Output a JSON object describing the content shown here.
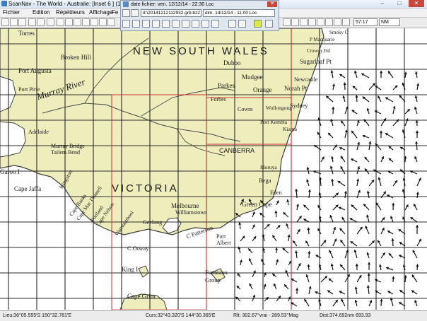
{
  "window": {
    "title": "ScanNav - The World - Australie: [Inset 6 ] (1:122...",
    "controls": {
      "minimize": "–",
      "maximize": "□",
      "close": "✕"
    }
  },
  "menu": {
    "items": [
      "Fichier",
      "Edition",
      "Répétiteurs",
      "Affichage",
      "Fe"
    ]
  },
  "toolbar": {
    "scale_value": "57:17",
    "unit_value": "NM"
  },
  "grib_panel": {
    "title": "date fichier: ven. 12/12/14 - 22:30 Loc",
    "file_path": "d:\\20141212112932.grb.bz2",
    "date_value": "dim. 14/12/14 - 11:00 Loc",
    "close_label": "✕"
  },
  "map": {
    "regions": [
      {
        "id": "nsw",
        "text": "NEW SOUTH WALES"
      },
      {
        "id": "vic",
        "text": "VICTORIA"
      }
    ],
    "places": [
      {
        "id": "torres",
        "text": "Torres"
      },
      {
        "id": "broken-hill",
        "text": "Broken Hill"
      },
      {
        "id": "port-augusta",
        "text": "Port Augusta"
      },
      {
        "id": "port-pirie",
        "text": "Port Pirie"
      },
      {
        "id": "murray-river",
        "text": "Murray River"
      },
      {
        "id": "adelaide",
        "text": "Adelaide"
      },
      {
        "id": "murray-bridge",
        "text": "Murray Bridge"
      },
      {
        "id": "tailem-bend",
        "text": "Tailem Bend"
      },
      {
        "id": "kingston",
        "text": "Kingston"
      },
      {
        "id": "cape-jaffa",
        "text": "Cape Jaffa"
      },
      {
        "id": "cape-banks",
        "text": "Cape Banks"
      },
      {
        "id": "cape-mac-donnell",
        "text": "Cape Mac Donnell"
      },
      {
        "id": "portland",
        "text": "Portland"
      },
      {
        "id": "cape-nelson",
        "text": "Cape Nelson"
      },
      {
        "id": "warrnambool",
        "text": "Warrnambool"
      },
      {
        "id": "dubbo",
        "text": "Dubbo"
      },
      {
        "id": "mudgee",
        "text": "Mudgee"
      },
      {
        "id": "parkes",
        "text": "Parkes"
      },
      {
        "id": "orange",
        "text": "Orange"
      },
      {
        "id": "forbes",
        "text": "Forbes"
      },
      {
        "id": "cowra",
        "text": "Cowra"
      },
      {
        "id": "canberra",
        "text": "CANBERRA"
      },
      {
        "id": "wollongong",
        "text": "Wollongong"
      },
      {
        "id": "port-kembla",
        "text": "Port Kembla"
      },
      {
        "id": "kiama",
        "text": "Kiama"
      },
      {
        "id": "sydney",
        "text": "Sydney"
      },
      {
        "id": "newcastle",
        "text": "Newcastle"
      },
      {
        "id": "norah-pt",
        "text": "Norah Pt"
      },
      {
        "id": "sugarloaf-pt",
        "text": "Sugarloaf Pt"
      },
      {
        "id": "crowdy-hd",
        "text": "Crowdy Hd"
      },
      {
        "id": "p-macquarie",
        "text": "P Macquarie"
      },
      {
        "id": "smoky-c",
        "text": "Smoky C"
      },
      {
        "id": "moruya",
        "text": "Moruya"
      },
      {
        "id": "bega",
        "text": "Bega"
      },
      {
        "id": "eden",
        "text": "Eden"
      },
      {
        "id": "green-cape",
        "text": "Green Cape"
      },
      {
        "id": "melbourne",
        "text": "Melbourne"
      },
      {
        "id": "williamstown",
        "text": "Williamstown"
      },
      {
        "id": "geelong",
        "text": "Geelong"
      },
      {
        "id": "c-patterson",
        "text": "C Patterson"
      },
      {
        "id": "c-otway",
        "text": "C Otway"
      },
      {
        "id": "port-albert",
        "text": "Port Albert"
      },
      {
        "id": "king-i",
        "text": "King I"
      },
      {
        "id": "furneaux-group",
        "text": "Furneaux Group"
      },
      {
        "id": "cape-grim",
        "text": "Cape Grim"
      },
      {
        "id": "garoo-i",
        "text": "Garoo I"
      }
    ]
  },
  "status": {
    "cursor_left": "Lieu:36°05.555'S 150°32.781'E",
    "cursor_mid": "Curs:32°43.320'S 144°30.365'E",
    "bearing": "Rlt: 302.67°vrai - 289.53°Mag",
    "distance": "Dist:374.692nm 693.93"
  },
  "colors": {
    "land": "#eeeebd",
    "sea": "#ffffff",
    "grid": "#2a2a2a",
    "coast": "#3d3d3d",
    "highlight": "#cc3333",
    "titlebar": "#dbe7f4"
  }
}
